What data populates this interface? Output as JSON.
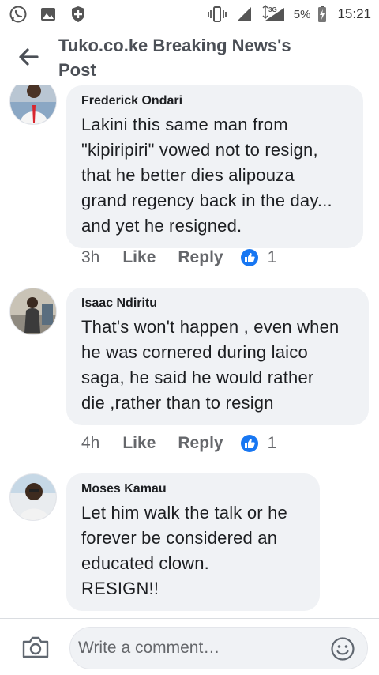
{
  "status_bar": {
    "battery_text": "5%",
    "network_text": "3G",
    "time": "15:21",
    "left_icons": [
      "whatsapp-icon",
      "gallery-icon",
      "shield-icon"
    ],
    "right_icons": [
      "vibrate-icon",
      "signal-icon",
      "signal-icon",
      "battery-icon"
    ]
  },
  "header": {
    "back_icon": "back-arrow-icon",
    "title": "Tuko.co.ke Breaking News's\nPost"
  },
  "comments": [
    {
      "author": "Frederick Ondari",
      "text": "Lakini this same man from\n\"kipiripiri\" vowed not to resign,\nthat he better dies alipouza\ngrand regency back in the day...\nand yet he resigned.",
      "time": "3h",
      "like_label": "Like",
      "reply_label": "Reply",
      "reaction_count": "1",
      "reaction_icon": "thumbs-up-icon"
    },
    {
      "author": "Isaac Ndiritu",
      "text": "That's won't happen , even when\nhe was cornered during laico\nsaga, he said he would rather\ndie ,rather than to resign",
      "time": "4h",
      "like_label": "Like",
      "reply_label": "Reply",
      "reaction_count": "1",
      "reaction_icon": "thumbs-up-icon"
    },
    {
      "author": "Moses Kamau",
      "text": "Let him walk the talk or he\nforever be considered an\neducated clown.\nRESIGN!!",
      "time": "",
      "like_label": "",
      "reply_label": "",
      "reaction_count": "",
      "reaction_icon": ""
    }
  ],
  "composer": {
    "placeholder": "Write a comment…",
    "camera_icon": "camera-icon",
    "emoji_icon": "emoji-icon"
  },
  "colors": {
    "bubble": "#f0f2f5",
    "like_blue": "#1877f2",
    "secondary_text": "#65676b",
    "title_text": "#4b4f56"
  }
}
